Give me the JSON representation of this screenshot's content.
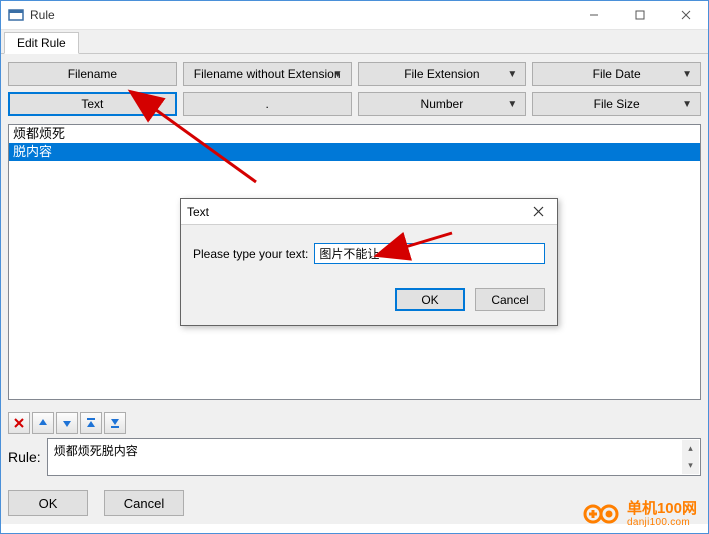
{
  "window": {
    "title": "Rule",
    "tab": "Edit Rule"
  },
  "tag_buttons": {
    "row1": [
      {
        "label": "Filename",
        "dropdown": false,
        "active": false
      },
      {
        "label": "Filename without Extension",
        "dropdown": true,
        "active": false
      },
      {
        "label": "File Extension",
        "dropdown": true,
        "active": false
      },
      {
        "label": "File Date",
        "dropdown": true,
        "active": false
      }
    ],
    "row2": [
      {
        "label": "Text",
        "dropdown": false,
        "active": true
      },
      {
        "label": ".",
        "dropdown": false,
        "active": false
      },
      {
        "label": "Number",
        "dropdown": true,
        "active": false
      },
      {
        "label": "File Size",
        "dropdown": true,
        "active": false
      }
    ]
  },
  "list_items": [
    {
      "text": "烦都烦死",
      "selected": false
    },
    {
      "text": "脱内容",
      "selected": true
    }
  ],
  "toolbar_icons": [
    "delete-icon",
    "arrow-up-icon",
    "arrow-down-icon",
    "arrow-top-icon",
    "arrow-bottom-icon"
  ],
  "rule": {
    "label": "Rule:",
    "value": "烦都烦死脱内容"
  },
  "bottom_buttons": {
    "ok": "OK",
    "cancel": "Cancel"
  },
  "modal": {
    "title": "Text",
    "prompt": "Please type your text:",
    "value": "图片不能让",
    "ok": "OK",
    "cancel": "Cancel"
  },
  "watermark": {
    "cn": "单机100网",
    "url": "danji100.com"
  }
}
